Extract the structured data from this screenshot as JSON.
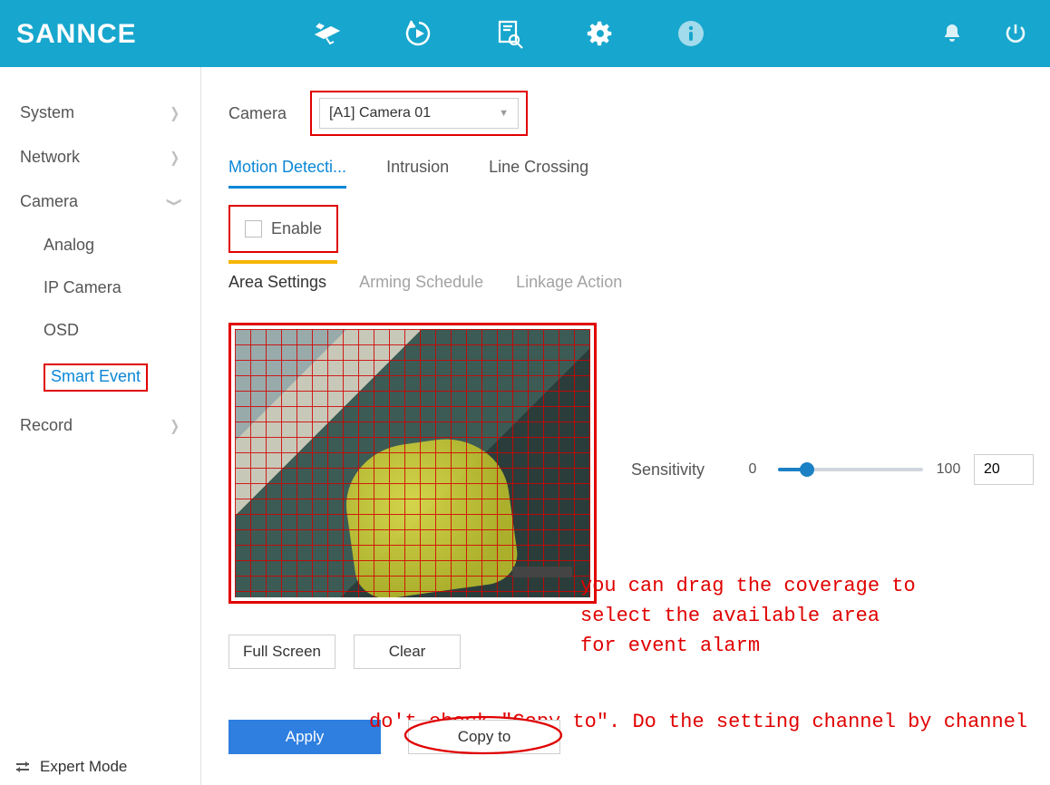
{
  "brand": "SANNCE",
  "sidebar": {
    "items": [
      {
        "label": "System",
        "expanded": false
      },
      {
        "label": "Network",
        "expanded": false
      },
      {
        "label": "Camera",
        "expanded": true,
        "children": [
          {
            "label": "Analog"
          },
          {
            "label": "IP Camera"
          },
          {
            "label": "OSD"
          },
          {
            "label": "Smart Event",
            "active": true
          }
        ]
      },
      {
        "label": "Record",
        "expanded": false
      }
    ],
    "expert_mode": "Expert Mode"
  },
  "content": {
    "camera_label": "Camera",
    "camera_selected": "[A1] Camera 01",
    "event_tabs": [
      {
        "label": "Motion Detecti...",
        "active": true
      },
      {
        "label": "Intrusion"
      },
      {
        "label": "Line Crossing"
      }
    ],
    "enable_label": "Enable",
    "enable_checked": false,
    "sub_tabs": [
      {
        "label": "Area Settings",
        "active": true
      },
      {
        "label": "Arming Schedule"
      },
      {
        "label": "Linkage Action"
      }
    ],
    "sensitivity": {
      "label": "Sensitivity",
      "min": "0",
      "max": "100",
      "value": "20"
    },
    "buttons": {
      "full_screen": "Full Screen",
      "clear": "Clear",
      "apply": "Apply",
      "copy_to": "Copy to"
    },
    "annotations": {
      "coverage": "you can drag the coverage to select the available area for event alarm",
      "copy_warning": "do't check \"Copy to\". Do the setting channel by channel"
    }
  }
}
